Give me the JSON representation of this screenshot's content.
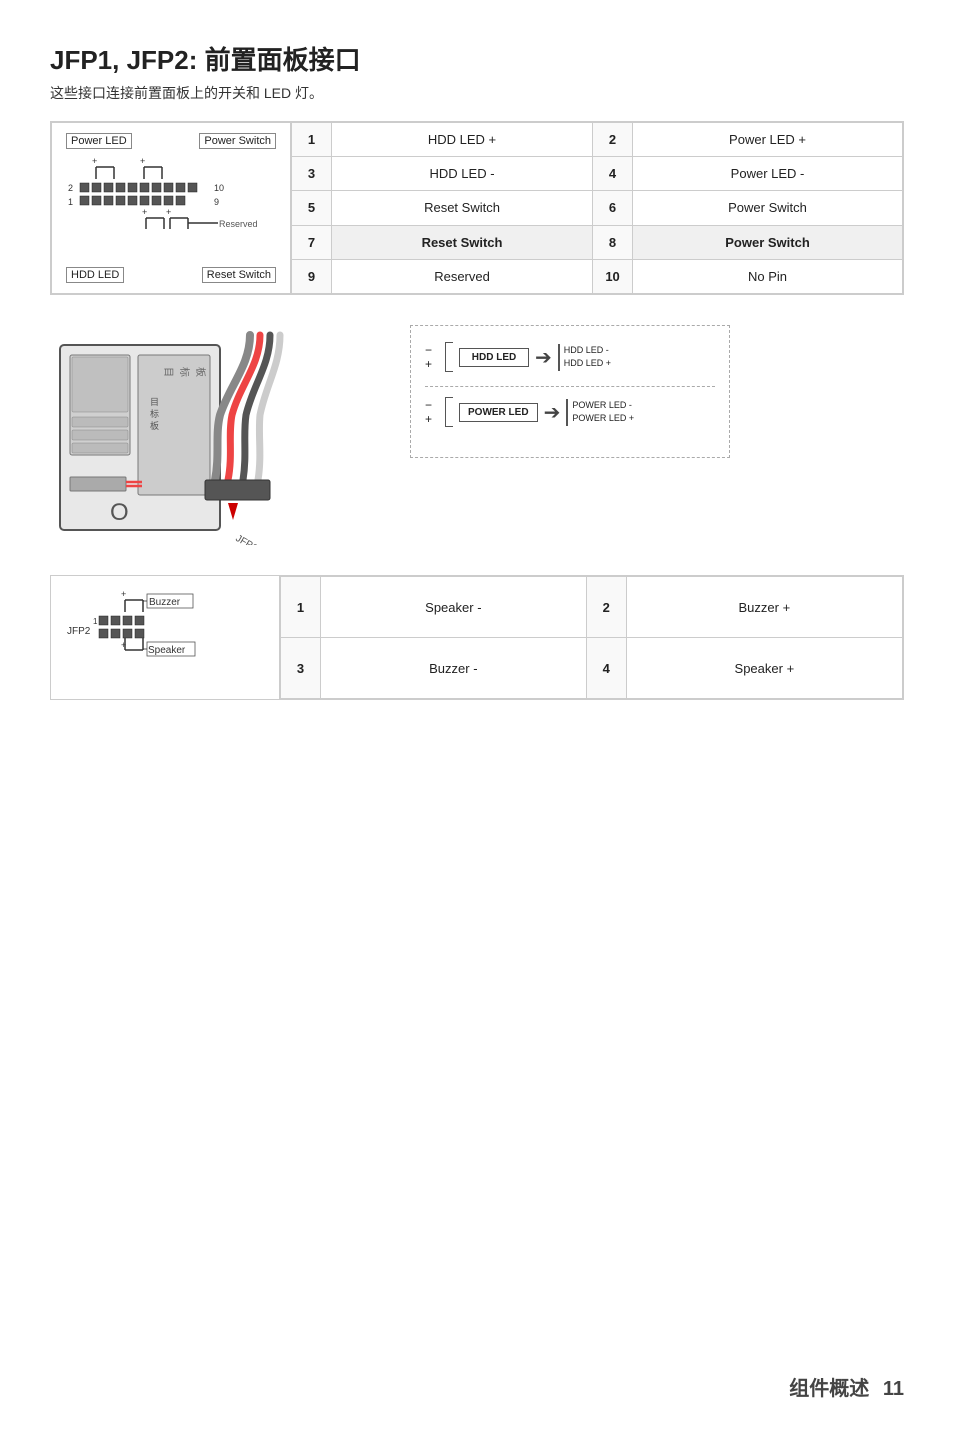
{
  "title": "JFP1, JFP2: 前置面板接口",
  "subtitle": "这些接口连接前置面板上的开关和 LED 灯。",
  "jfp1": {
    "diagram_labels": {
      "top_left": "Power LED",
      "top_right": "Power Switch",
      "bottom_left": "HDD LED",
      "bottom_right": "Reset Switch",
      "reserved": "Reserved",
      "pin_numbers": [
        "2",
        "1",
        "10",
        "9"
      ]
    },
    "table": [
      {
        "pin1": "1",
        "label1": "HDD LED +",
        "pin2": "2",
        "label2": "Power LED +"
      },
      {
        "pin1": "3",
        "label1": "HDD LED -",
        "pin2": "4",
        "label2": "Power LED -"
      },
      {
        "pin1": "5",
        "label1": "Reset Switch",
        "pin2": "6",
        "label2": "Power Switch"
      },
      {
        "pin1": "7",
        "label1": "Reset Switch",
        "pin2": "8",
        "label2": "Power Switch",
        "highlight": true
      },
      {
        "pin1": "9",
        "label1": "Reserved",
        "pin2": "10",
        "label2": "No Pin"
      }
    ]
  },
  "led_diagram": {
    "hdd_label": "HDD LED",
    "hdd_plus": "HDD LED +",
    "hdd_minus": "HDD LED -",
    "power_label": "POWER LED",
    "power_plus": "POWER LED +",
    "power_minus": "POWER LED -"
  },
  "jfp2": {
    "label": "JFP2",
    "buzzer_label": "Buzzer",
    "speaker_label": "Speaker",
    "table": [
      {
        "pin1": "1",
        "label1": "Speaker -",
        "pin2": "2",
        "label2": "Buzzer +"
      },
      {
        "pin1": "3",
        "label1": "Buzzer -",
        "pin2": "4",
        "label2": "Speaker +"
      }
    ]
  },
  "footer": {
    "text": "组件概述",
    "page": "11"
  }
}
